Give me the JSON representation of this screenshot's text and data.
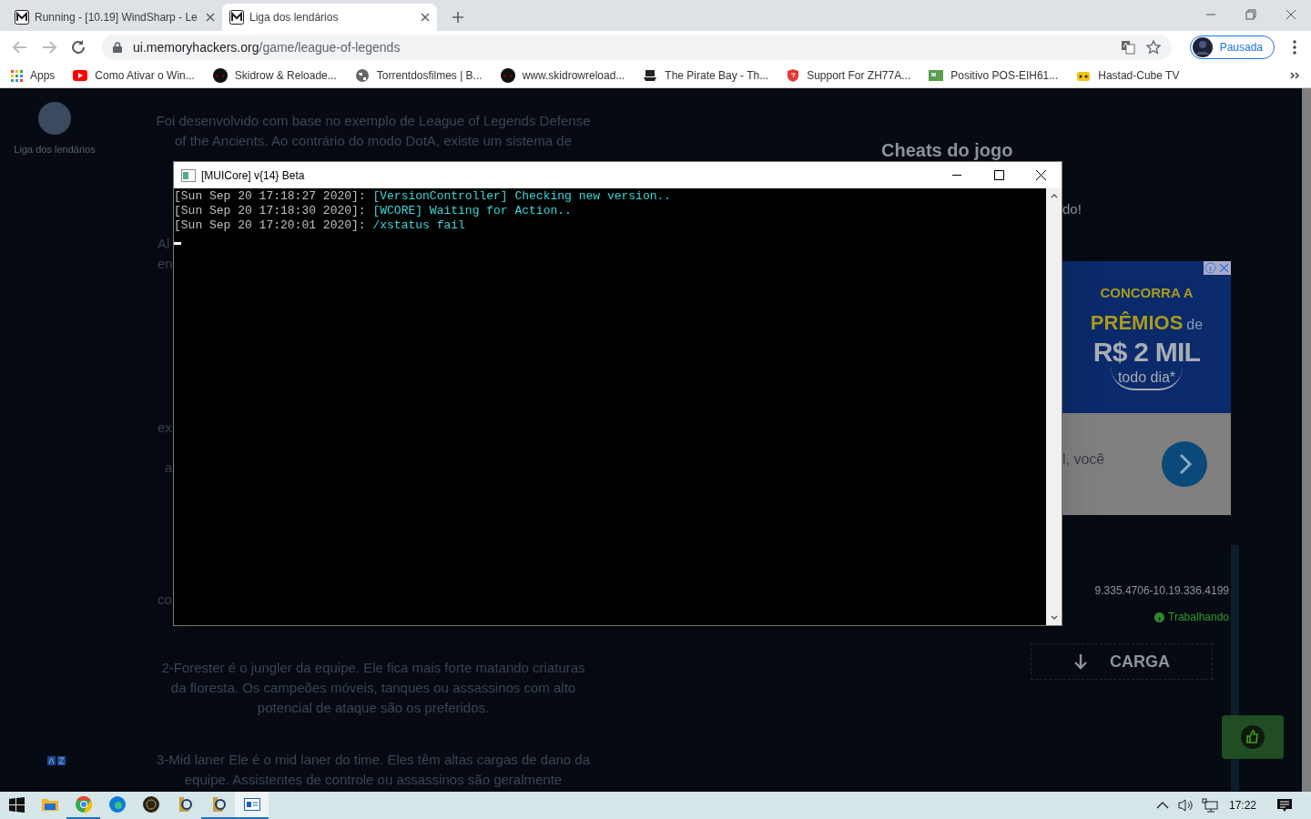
{
  "browser": {
    "tabs": [
      {
        "title": "Running - [10.19] WindSharp - Le",
        "selected": false
      },
      {
        "title": "Liga dos lendários",
        "selected": true
      }
    ],
    "url": {
      "host": "ui.memoryhackers.org",
      "path": "/game/league-of-legends"
    },
    "profile": {
      "label": "Pausada"
    },
    "bookmarks": [
      {
        "kind": "apps",
        "label": "Apps"
      },
      {
        "kind": "video",
        "label": "Como Ativar o Win..."
      },
      {
        "kind": "mask",
        "label": "Skidrow & Reloade..."
      },
      {
        "kind": "globe",
        "label": "Torrentdosfilmes | B..."
      },
      {
        "kind": "mask",
        "label": "www.skidrowreload..."
      },
      {
        "kind": "ship",
        "label": "The Pirate Bay - Th..."
      },
      {
        "kind": "shield",
        "label": "Support For ZH77A..."
      },
      {
        "kind": "board",
        "label": "Positivo POS-EIH61..."
      },
      {
        "kind": "robot",
        "label": "Hastad-Cube TV"
      }
    ]
  },
  "page": {
    "site_label": "Liga dos lendários",
    "intro_lines": [
      "Foi desenvolvido com base no exemplo de League of Legends Defense",
      "of the Ancients. Ao contrário do modo DotA, existe um sistema de"
    ],
    "edge_fragments": [
      "Al",
      "en",
      "ex",
      "a",
      "co"
    ],
    "paragraphs": [
      "2-Forester é o jungler da equipe. Ele fica mais forte matando criaturas da floresta. Os campeões móveis, tanques ou assassinos com alto potencial de ataque são os preferidos.",
      "3-Mid laner Ele é o mid laner do time. Eles têm altas cargas de dano da equipe. Assistentes de controle ou assassinos são geralmente"
    ],
    "cheats_title": "Cheats do jogo",
    "cheats_fragment": "do!",
    "ad": {
      "line_1": "CONCORRA A",
      "line_2": "PRÊMIOS",
      "line_2_suffix": "de",
      "line_3": "R$ 2 MIL",
      "line_4": "todo dia*",
      "caption": "l, você"
    },
    "version": "9.335.4706-10.19.336.4199",
    "status": "Trabalhando",
    "load_button": "CARGA"
  },
  "console": {
    "title": "[MUICore] v{14} Beta",
    "lines": [
      {
        "timestamp": "[Sun Sep 20 17:18:27 2020]:",
        "message": "[VersionController] Checking new version.."
      },
      {
        "timestamp": "[Sun Sep 20 17:18:30 2020]:",
        "message": "[WCORE] Waiting for Action.."
      },
      {
        "timestamp": "[Sun Sep 20 17:20:01 2020]:",
        "message": "/xstatus fail"
      }
    ]
  },
  "taskbar": {
    "apps": [
      {
        "kind": "folder",
        "running": false,
        "selected": false
      },
      {
        "kind": "chrome",
        "running": true,
        "selected": false
      },
      {
        "kind": "edge",
        "running": false,
        "selected": false
      },
      {
        "kind": "coin",
        "running": false,
        "selected": false
      },
      {
        "kind": "league",
        "running": false,
        "selected": false
      },
      {
        "kind": "league",
        "running": true,
        "selected": false
      },
      {
        "kind": "console",
        "running": true,
        "selected": true
      }
    ],
    "time": "17:22"
  }
}
